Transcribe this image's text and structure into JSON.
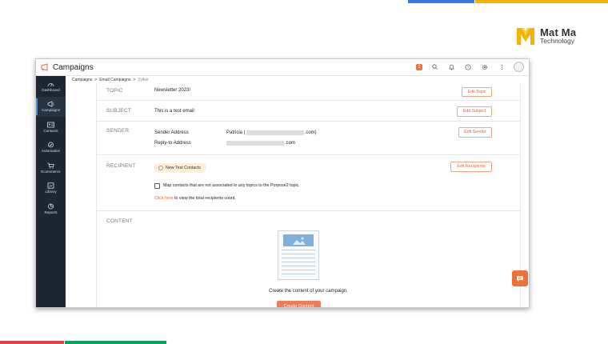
{
  "brand": {
    "name": "Mat Ma",
    "sub": "Technology",
    "logo_color": "#f4b400"
  },
  "app": {
    "title": "Campaigns",
    "accent": "#e8673c",
    "badge": "1"
  },
  "topbar_icons": [
    "notification-badge",
    "search-icon",
    "bell-icon",
    "help-icon",
    "settings-icon",
    "more-icon",
    "avatar"
  ],
  "sidebar": {
    "items": [
      {
        "label": "Dashboard",
        "icon": "dashboard-icon",
        "active": false
      },
      {
        "label": "Campaigns",
        "icon": "megaphone-icon",
        "active": true
      },
      {
        "label": "Contacts",
        "icon": "contacts-icon",
        "active": false
      },
      {
        "label": "Automation",
        "icon": "automation-icon",
        "active": false
      },
      {
        "label": "Ecommerce",
        "icon": "cart-icon",
        "active": false
      },
      {
        "label": "Library",
        "icon": "library-icon",
        "active": false
      },
      {
        "label": "Reports",
        "icon": "reports-icon",
        "active": false
      }
    ]
  },
  "breadcrumb": {
    "items": [
      "Campaigns",
      "Email Campaigns",
      "Zylker"
    ],
    "sep": ">"
  },
  "sections": {
    "topic": {
      "label": "TOPIC",
      "value": "Newsletter 2023!",
      "button": "Edit Topic"
    },
    "subject": {
      "label": "SUBJECT",
      "value": "This is a test email",
      "button": "Edit Subject"
    },
    "sender": {
      "label": "SENDER",
      "sender_label": "Sender Address",
      "sender_value_prefix": "Patricia (",
      "sender_value_suffix": ".com)",
      "reply_label": "Reply-to Address",
      "reply_value_suffix": ".com",
      "button": "Edit Sender"
    },
    "recipient": {
      "label": "RECIPIENT",
      "pill": "New Test Contacts",
      "checkbox_text": "Map contacts that are not associated to any topics to the Purpose2 topic.",
      "link": "Click here",
      "link_suffix": " to view the total recipients count.",
      "button": "Edit Recipients"
    },
    "content": {
      "label": "CONTENT",
      "description": "Create the content of your campaign.",
      "button": "Create Content"
    }
  }
}
